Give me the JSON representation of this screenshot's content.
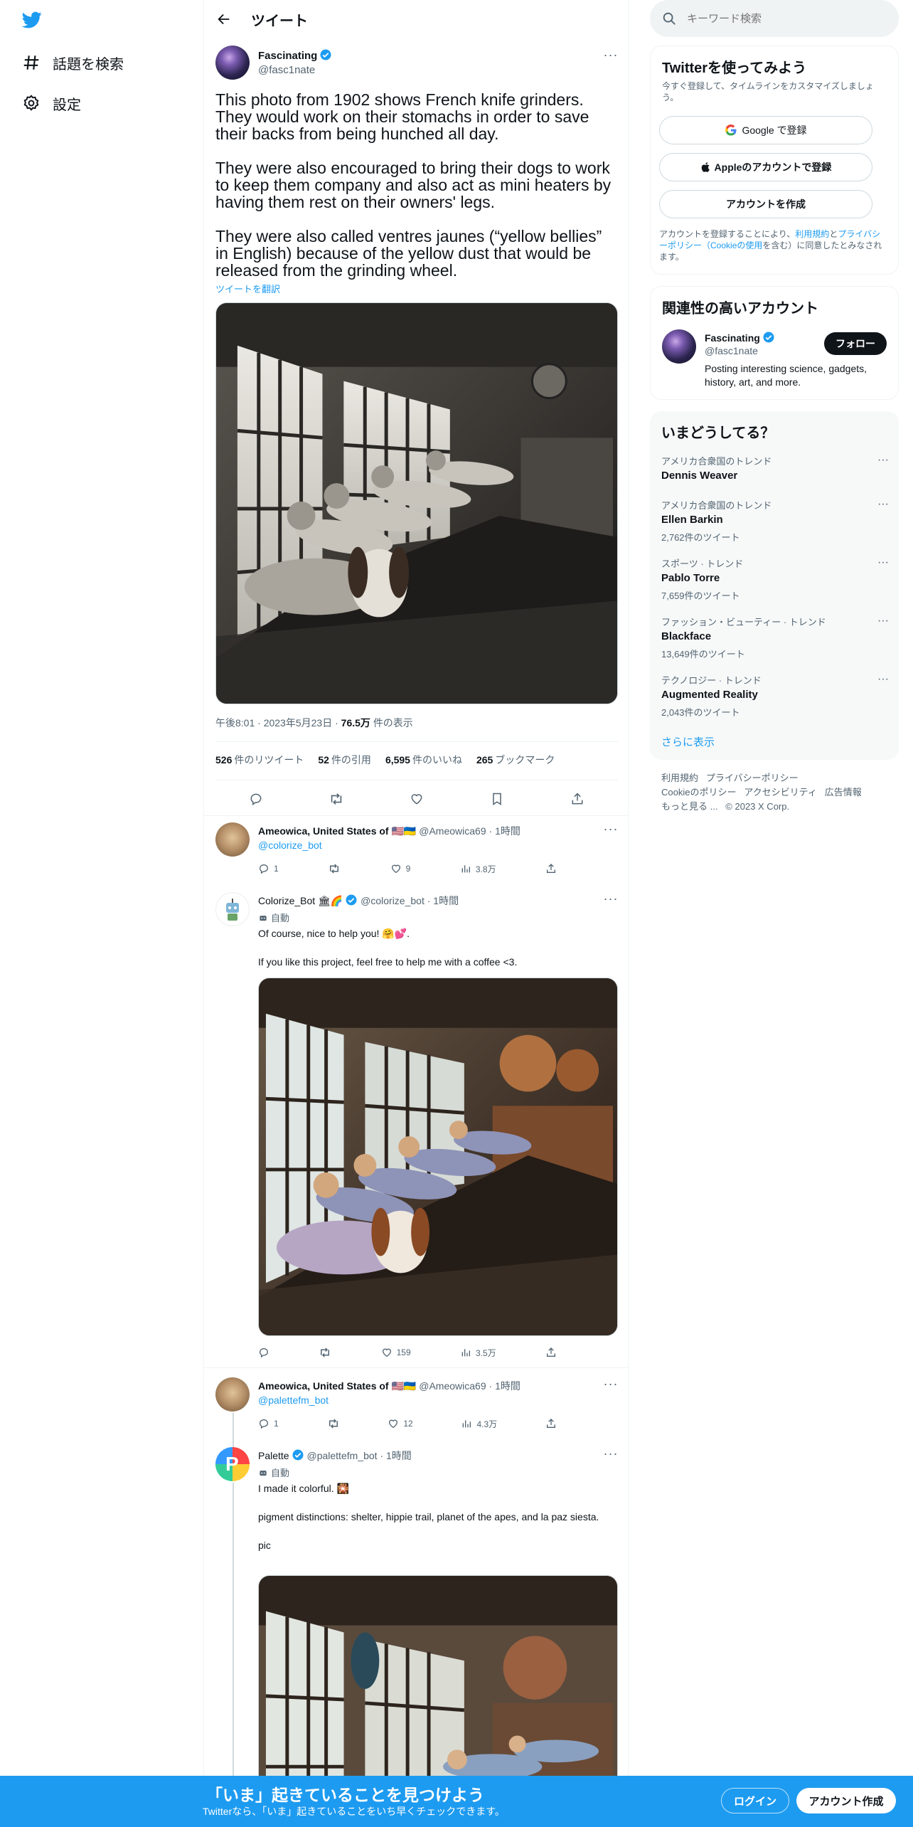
{
  "nav": {
    "explore_label": "話題を検索",
    "settings_label": "設定"
  },
  "header": {
    "back_icon": "arrow-left-icon",
    "title": "ツイート"
  },
  "tweet": {
    "author_name": "Fascinating",
    "author_handle": "@fasc1nate",
    "text": "This photo from 1902 shows French knife grinders. They would work on their stomachs in order to save their backs from being hunched all day.\n\nThey were also encouraged to bring their dogs to work to keep them company and also act as mini heaters by having them rest on their owners' legs.\n\nThey were also called ventres jaunes (“yellow bellies” in English) because of the yellow dust that would be released from the grinding wheel.",
    "translate_label": "ツイートを翻訳",
    "time": "午後8:01",
    "date": "2023年5月23日",
    "views_value": "76.5万",
    "views_label": "件の表示",
    "stats": [
      {
        "value": "526",
        "label": "件のリツイート"
      },
      {
        "value": "52",
        "label": "件の引用"
      },
      {
        "value": "6,595",
        "label": "件のいいね"
      },
      {
        "value": "265",
        "label": "ブックマーク"
      }
    ]
  },
  "replies": [
    {
      "name": "Ameowica, United States of 🇺🇸🇺🇦",
      "handle": "@Ameowica69",
      "time": "1時間",
      "mention": "@colorize_bot",
      "replies": "1",
      "likes": "9",
      "views": "3.8万"
    },
    {
      "name": "Colorize_Bot 🏛🌈",
      "handle": "@colorize_bot",
      "time": "1時間",
      "auto": "自動",
      "text": "Of course, nice to help you! 🤗💕.\n\nIf you like this project, feel free to help me with a coffee <3.",
      "likes": "159",
      "views": "3.5万"
    },
    {
      "name": "Ameowica, United States of 🇺🇸🇺🇦",
      "handle": "@Ameowica69",
      "time": "1時間",
      "mention": "@palettefm_bot",
      "replies": "1",
      "likes": "12",
      "views": "4.3万"
    },
    {
      "name": "Palette",
      "handle": "@palettefm_bot",
      "time": "1時間",
      "auto": "自動",
      "text": "I made it colorful. 🎇\n\npigment distinctions: shelter, hippie trail, planet of the apes, and la paz siesta.\n\npic"
    }
  ],
  "sidebar": {
    "search_placeholder": "キーワード検索",
    "signup": {
      "title": "Twitterを使ってみよう",
      "subtitle": "今すぐ登録して、タイムラインをカスタマイズしましょう。",
      "google_label": "Google で登録",
      "apple_label": "Appleのアカウントで登録",
      "create_label": "アカウントを作成",
      "legal_prefix": "アカウントを登録することにより、",
      "terms": "利用規約",
      "and": "と",
      "privacy": "プライバシーポリシー",
      "cookie": "（Cookieの使用",
      "legal_suffix": "を含む）に同意したとみなされます。"
    },
    "relevant": {
      "title": "関連性の高いアカウント",
      "name": "Fascinating",
      "handle": "@fasc1nate",
      "follow_label": "フォロー",
      "bio": "Posting interesting science, gadgets, history, art, and more."
    },
    "trends": {
      "title": "いまどうしてる？",
      "items": [
        {
          "category": "アメリカ合衆国のトレンド",
          "name": "Dennis Weaver",
          "count": ""
        },
        {
          "category": "アメリカ合衆国のトレンド",
          "name": "Ellen Barkin",
          "count": "2,762件のツイート"
        },
        {
          "category": "スポーツ · トレンド",
          "name": "Pablo Torre",
          "count": "7,659件のツイート"
        },
        {
          "category": "ファッション・ビューティー · トレンド",
          "name": "Blackface",
          "count": "13,649件のツイート"
        },
        {
          "category": "テクノロジー · トレンド",
          "name": "Augmented Reality",
          "count": "2,043件のツイート"
        }
      ],
      "show_more": "さらに表示"
    },
    "footer": {
      "line1": [
        "利用規約",
        "プライバシーポリシー"
      ],
      "line2": [
        "Cookieのポリシー",
        "アクセシビリティ",
        "広告情報"
      ],
      "more": "もっと見る ...",
      "copyright": "© 2023 X Corp."
    }
  },
  "bottom_bar": {
    "title": "「いま」起きていることを見つけよう",
    "subtitle": "Twitterなら、「いま」起きていることをいち早くチェックできます。",
    "login_label": "ログイン",
    "signup_label": "アカウント作成"
  },
  "colors": {
    "accent": "#1d9bf0",
    "text": "#0f1419",
    "secondary": "#536471"
  }
}
